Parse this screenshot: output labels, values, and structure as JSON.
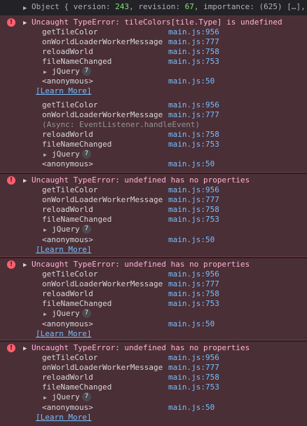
{
  "object_row": {
    "prefix": "Object { ",
    "k1": "version: ",
    "v1": "243",
    "sep1": ", ",
    "k2": "revision: ",
    "v2": "67",
    "sep2": ", ",
    "k3": "importance: ",
    "v3": "(625) […]",
    "suffix": ", …"
  },
  "errors": [
    {
      "message": "Uncaught TypeError: tileColors[tile.Type] is undefined",
      "stack1": [
        {
          "fn": "getTileColor",
          "loc": "main.js:956"
        },
        {
          "fn": "onWorldLoaderWorkerMessage",
          "loc": "main.js:777"
        },
        {
          "fn": "reloadWorld",
          "loc": "main.js:758"
        },
        {
          "fn": "fileNameChanged",
          "loc": "main.js:753"
        },
        {
          "fn": "jQuery",
          "count": "7"
        },
        {
          "fn": "<anonymous>",
          "loc": "main.js:50"
        }
      ],
      "learn_more": "[Learn More]",
      "stack2": [
        {
          "fn": "getTileColor",
          "loc": "main.js:956"
        },
        {
          "fn": "onWorldLoaderWorkerMessage",
          "loc": "main.js:777"
        },
        {
          "fn": "(Async: EventListener.handleEvent)"
        },
        {
          "fn": "reloadWorld",
          "loc": "main.js:758"
        },
        {
          "fn": "fileNameChanged",
          "loc": "main.js:753"
        },
        {
          "fn": "jQuery",
          "count": "7"
        },
        {
          "fn": "<anonymous>",
          "loc": "main.js:50"
        }
      ]
    },
    {
      "message": "Uncaught TypeError: undefined has no properties",
      "stack": [
        {
          "fn": "getTileColor",
          "loc": "main.js:956"
        },
        {
          "fn": "onWorldLoaderWorkerMessage",
          "loc": "main.js:777"
        },
        {
          "fn": "reloadWorld",
          "loc": "main.js:758"
        },
        {
          "fn": "fileNameChanged",
          "loc": "main.js:753"
        },
        {
          "fn": "jQuery",
          "count": "7"
        },
        {
          "fn": "<anonymous>",
          "loc": "main.js:50"
        }
      ],
      "learn_more": "[Learn More]"
    },
    {
      "message": "Uncaught TypeError: undefined has no properties",
      "stack": [
        {
          "fn": "getTileColor",
          "loc": "main.js:956"
        },
        {
          "fn": "onWorldLoaderWorkerMessage",
          "loc": "main.js:777"
        },
        {
          "fn": "reloadWorld",
          "loc": "main.js:758"
        },
        {
          "fn": "fileNameChanged",
          "loc": "main.js:753"
        },
        {
          "fn": "jQuery",
          "count": "7"
        },
        {
          "fn": "<anonymous>",
          "loc": "main.js:50"
        }
      ],
      "learn_more": "[Learn More]"
    },
    {
      "message": "Uncaught TypeError: undefined has no properties",
      "stack": [
        {
          "fn": "getTileColor",
          "loc": "main.js:956"
        },
        {
          "fn": "onWorldLoaderWorkerMessage",
          "loc": "main.js:777"
        },
        {
          "fn": "reloadWorld",
          "loc": "main.js:758"
        },
        {
          "fn": "fileNameChanged",
          "loc": "main.js:753"
        },
        {
          "fn": "jQuery",
          "count": "7"
        },
        {
          "fn": "<anonymous>",
          "loc": "main.js:50"
        }
      ],
      "learn_more": "[Learn More]"
    }
  ],
  "icons": {
    "error": "error-icon",
    "expand": "expand-triangle-icon"
  }
}
